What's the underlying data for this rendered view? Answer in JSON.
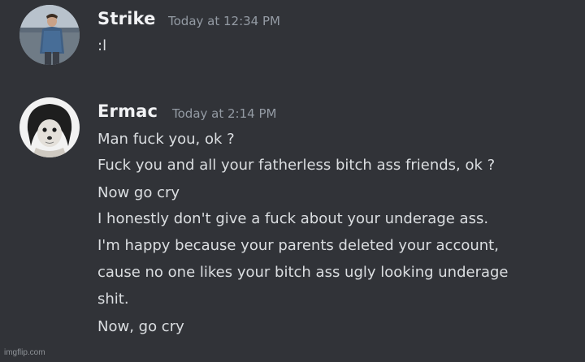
{
  "messages": [
    {
      "username": "Strike",
      "timestamp": "Today at 12:34 PM",
      "lines": [
        ":l"
      ]
    },
    {
      "username": "Ermac",
      "timestamp": "Today at 2:14 PM",
      "lines": [
        "Man fuck you, ok ?",
        "Fuck you and all your fatherless bitch ass friends, ok ?",
        "Now go cry",
        "I honestly don't give a fuck about your underage ass.",
        "I'm happy because your parents deleted your account,",
        "cause no one likes your bitch ass ugly looking underage",
        "shit.",
        "Now, go cry"
      ]
    }
  ],
  "watermark": "imgflip.com",
  "colors": {
    "background": "#313338",
    "username": "#f2f3f5",
    "timestamp": "#949ba4",
    "text": "#dbdee1"
  }
}
